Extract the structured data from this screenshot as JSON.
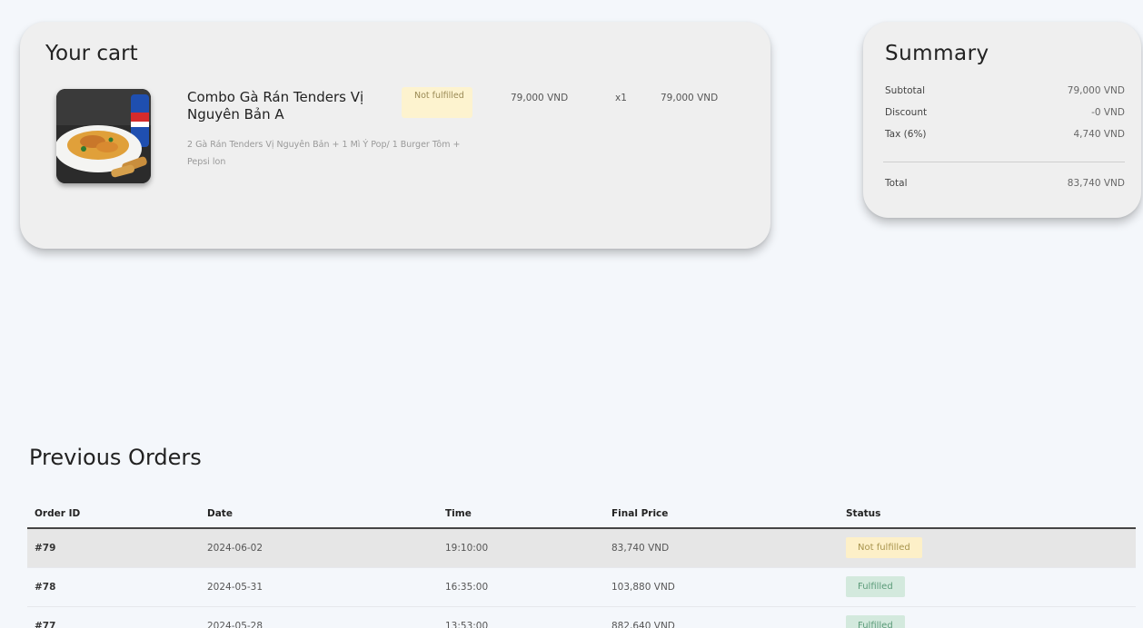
{
  "cart": {
    "title": "Your cart",
    "items": [
      {
        "name": "Combo Gà Rán Tenders Vị Nguyên Bản A",
        "status": "Not fulfilled",
        "description": "2 Gà Rán Tenders Vị Nguyên Bản + 1 Mì Ý Pop/ 1 Burger Tôm + Pepsi lon",
        "price": "79,000 VND",
        "quantity": "x1",
        "total": "79,000 VND"
      }
    ]
  },
  "summary": {
    "title": "Summary",
    "subtotal_label": "Subtotal",
    "subtotal_value": "79,000 VND",
    "discount_label": "Discount",
    "discount_value": "-0 VND",
    "tax_label": "Tax (6%)",
    "tax_value": "4,740 VND",
    "total_label": "Total",
    "total_value": "83,740 VND"
  },
  "orders": {
    "title": "Previous Orders",
    "columns": [
      "Order ID",
      "Date",
      "Time",
      "Final Price",
      "Status"
    ],
    "rows": [
      {
        "id": "#79",
        "date": "2024-06-02",
        "time": "19:10:00",
        "price": "83,740 VND",
        "status": "Not fulfilled"
      },
      {
        "id": "#78",
        "date": "2024-05-31",
        "time": "16:35:00",
        "price": "103,880 VND",
        "status": "Fulfilled"
      },
      {
        "id": "#77",
        "date": "2024-05-28",
        "time": "13:53:00",
        "price": "882,640 VND",
        "status": "Fulfilled"
      }
    ]
  },
  "colors": {
    "not_fulfilled_bg": "#fdf0c8",
    "fulfilled_bg": "#d3e9dd"
  }
}
